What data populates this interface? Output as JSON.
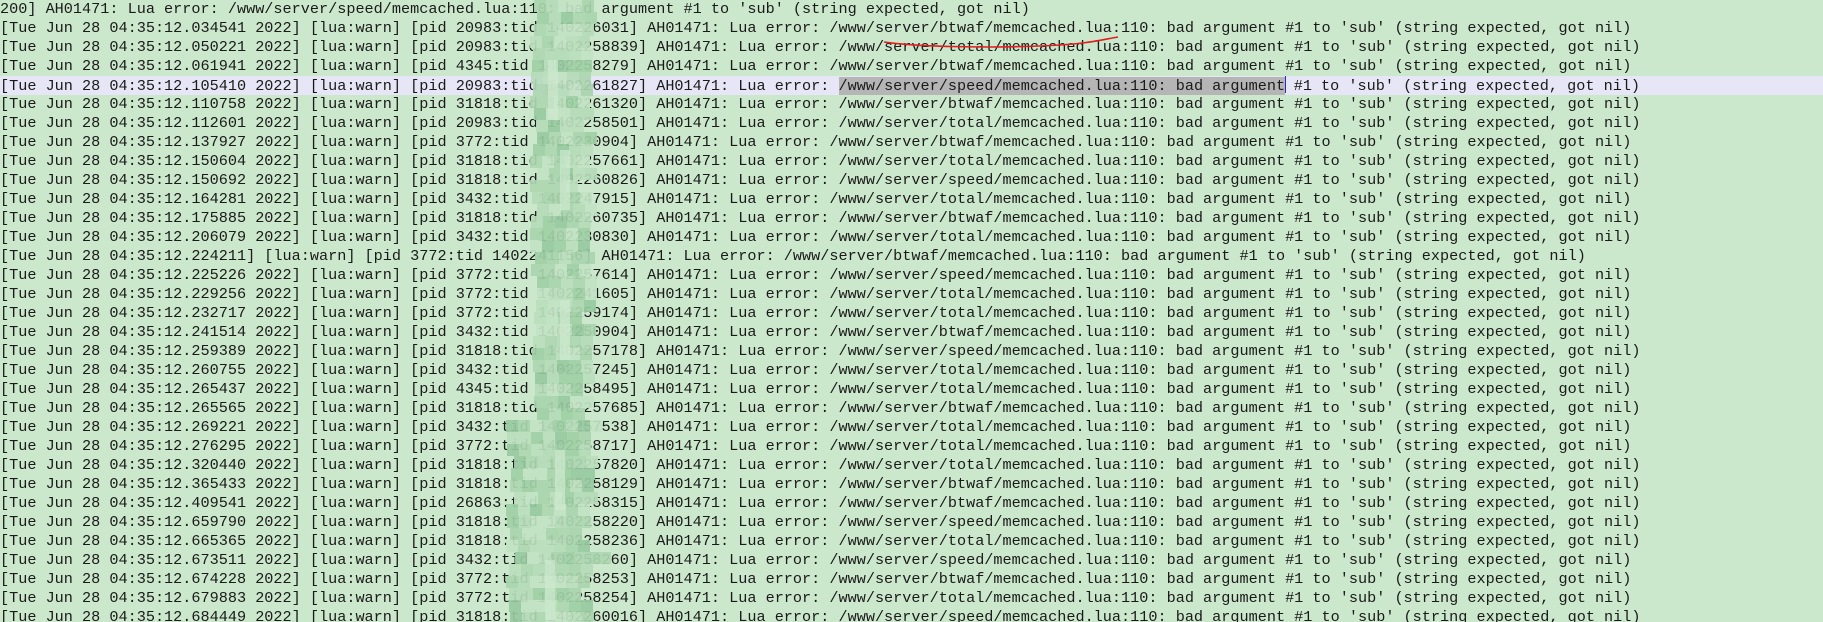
{
  "theme": {
    "background": "#cce8cc",
    "current_line": "#e6e6f7",
    "selection": "#b5b5b5",
    "annotation": "#e02020",
    "caret": "#2a2ad0"
  },
  "log": {
    "first_line": "200] AH01471: Lua error: /www/server/speed/memcached.lua:110: bad argument #1 to 'sub' (string expected, got nil)",
    "lines": [
      {
        "time": "Tue Jun 28 04:35:12.034541 2022",
        "pid": "20983",
        "tid": "140226031",
        "path": "/www/server/btwaf/memcached.lua"
      },
      {
        "time": "Tue Jun 28 04:35:12.050221 2022",
        "pid": "20983",
        "tid": "1402258839",
        "path": "/www/server/total/memcached.lua"
      },
      {
        "time": "Tue Jun 28 04:35:12.061941 2022",
        "pid": "4345",
        "tid": "1402258279",
        "path": "/www/server/btwaf/memcached.lua"
      },
      {
        "time": "Tue Jun 28 04:35:12.105410 2022",
        "pid": "20983",
        "tid": "1402261827",
        "path": "/www/server/speed/memcached.lua"
      },
      {
        "time": "Tue Jun 28 04:35:12.110758 2022",
        "pid": "31818",
        "tid": "1402261320",
        "path": "/www/server/btwaf/memcached.lua"
      },
      {
        "time": "Tue Jun 28 04:35:12.112601 2022",
        "pid": "20983",
        "tid": "1402258501",
        "path": "/www/server/total/memcached.lua"
      },
      {
        "time": "Tue Jun 28 04:35:12.137927 2022",
        "pid": "3772",
        "tid": "1402230904",
        "path": "/www/server/btwaf/memcached.lua"
      },
      {
        "time": "Tue Jun 28 04:35:12.150604 2022",
        "pid": "31818",
        "tid": "1402257661",
        "path": "/www/server/total/memcached.lua"
      },
      {
        "time": "Tue Jun 28 04:35:12.150692 2022",
        "pid": "31818",
        "tid": "1402260826",
        "path": "/www/server/speed/memcached.lua"
      },
      {
        "time": "Tue Jun 28 04:35:12.164281 2022",
        "pid": "3432",
        "tid": "1402247915",
        "path": "/www/server/total/memcached.lua"
      },
      {
        "time": "Tue Jun 28 04:35:12.175885 2022",
        "pid": "31818",
        "tid": "1402260735",
        "path": "/www/server/btwaf/memcached.lua"
      },
      {
        "time": "Tue Jun 28 04:35:12.206079 2022",
        "pid": "3432",
        "tid": "1402230830",
        "path": "/www/server/total/memcached.lua"
      },
      {
        "time": "Tue Jun 28 04:35:12.224211",
        "pid": "3772",
        "tid": "1402241156",
        "path": "/www/server/btwaf/memcached.lua"
      },
      {
        "time": "Tue Jun 28 04:35:12.225226 2022",
        "pid": "3772",
        "tid": "1402257614",
        "path": "/www/server/speed/memcached.lua"
      },
      {
        "time": "Tue Jun 28 04:35:12.229256 2022",
        "pid": "3772",
        "tid": "1402241605",
        "path": "/www/server/total/memcached.lua"
      },
      {
        "time": "Tue Jun 28 04:35:12.232717 2022",
        "pid": "3772",
        "tid": "1402259174",
        "path": "/www/server/total/memcached.lua"
      },
      {
        "time": "Tue Jun 28 04:35:12.241514 2022",
        "pid": "3432",
        "tid": "1402250904",
        "path": "/www/server/btwaf/memcached.lua"
      },
      {
        "time": "Tue Jun 28 04:35:12.259389 2022",
        "pid": "31818",
        "tid": "1402257178",
        "path": "/www/server/speed/memcached.lua"
      },
      {
        "time": "Tue Jun 28 04:35:12.260755 2022",
        "pid": "3432",
        "tid": "1402257245",
        "path": "/www/server/total/memcached.lua"
      },
      {
        "time": "Tue Jun 28 04:35:12.265437 2022",
        "pid": "4345",
        "tid": "1402258495",
        "path": "/www/server/total/memcached.lua"
      },
      {
        "time": "Tue Jun 28 04:35:12.265565 2022",
        "pid": "31818",
        "tid": "1402257685",
        "path": "/www/server/btwaf/memcached.lua"
      },
      {
        "time": "Tue Jun 28 04:35:12.269221 2022",
        "pid": "3432",
        "tid": "1402257538",
        "path": "/www/server/total/memcached.lua"
      },
      {
        "time": "Tue Jun 28 04:35:12.276295 2022",
        "pid": "3772",
        "tid": "1402258717",
        "path": "/www/server/total/memcached.lua"
      },
      {
        "time": "Tue Jun 28 04:35:12.320440 2022",
        "pid": "31818",
        "tid": "1402257820",
        "path": "/www/server/total/memcached.lua"
      },
      {
        "time": "Tue Jun 28 04:35:12.365433 2022",
        "pid": "31818",
        "tid": "1402258129",
        "path": "/www/server/btwaf/memcached.lua"
      },
      {
        "time": "Tue Jun 28 04:35:12.409541 2022",
        "pid": "26863",
        "tid": "1402258315",
        "path": "/www/server/btwaf/memcached.lua"
      },
      {
        "time": "Tue Jun 28 04:35:12.659790 2022",
        "pid": "31818",
        "tid": "1402258220",
        "path": "/www/server/speed/memcached.lua"
      },
      {
        "time": "Tue Jun 28 04:35:12.665365 2022",
        "pid": "31818",
        "tid": "1402258236",
        "path": "/www/server/total/memcached.lua"
      },
      {
        "time": "Tue Jun 28 04:35:12.673511 2022",
        "pid": "3432",
        "tid": "1402258260",
        "path": "/www/server/speed/memcached.lua"
      },
      {
        "time": "Tue Jun 28 04:35:12.674228 2022",
        "pid": "3772",
        "tid": "1402258253",
        "path": "/www/server/btwaf/memcached.lua"
      },
      {
        "time": "Tue Jun 28 04:35:12.679883 2022",
        "pid": "3772",
        "tid": "1402258254",
        "path": "/www/server/total/memcached.lua"
      },
      {
        "time": "Tue Jun 28 04:35:12.684449 2022",
        "pid": "31818",
        "tid": "1402260016",
        "path": "/www/server/speed/memcached.lua"
      }
    ]
  }
}
